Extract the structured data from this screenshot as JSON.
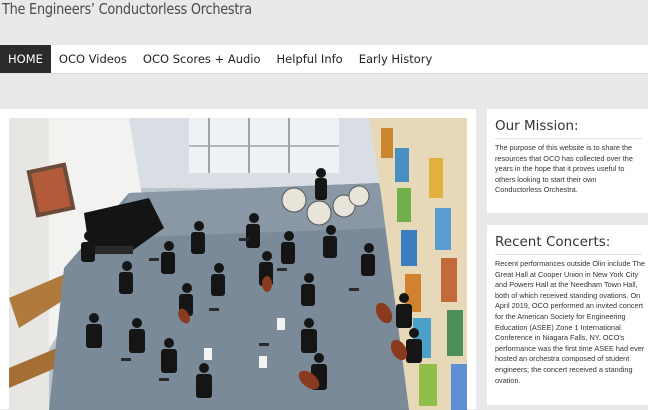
{
  "site": {
    "title": "The Engineers’ Conductorless Orchestra"
  },
  "nav": {
    "items": [
      {
        "label": "HOME",
        "active": true
      },
      {
        "label": "OCO Videos",
        "active": false
      },
      {
        "label": "OCO Scores + Audio",
        "active": false
      },
      {
        "label": "Helpful Info",
        "active": false
      },
      {
        "label": "Early History",
        "active": false
      }
    ]
  },
  "mission": {
    "title": "Our Mission:",
    "text": "The purpose of this website is to share the resources that OCO has collected over the years in the hope that it proves useful to others looking to start their own Conductorless Orchestra."
  },
  "concerts": {
    "title": "Recent Concerts:",
    "text": "Recent performances outside Olin include The Great Hall at Cooper Union in New York City and Powers Hall at the Needham Town Hall, both of which received standing ovations. On April 2019, OCO performed an invited concert for the American Society for Engineering Education (ASEE) Zone 1 International Conference in Niagara Falls, NY. OCO's performance was the first time ASEE had ever hosted an orchestra composed of student engineers; the concert received a standing ovation."
  },
  "colors": {
    "nav_active_bg": "#2b2b2b",
    "page_bg": "#e9e9e9",
    "card_bg": "#ffffff"
  }
}
